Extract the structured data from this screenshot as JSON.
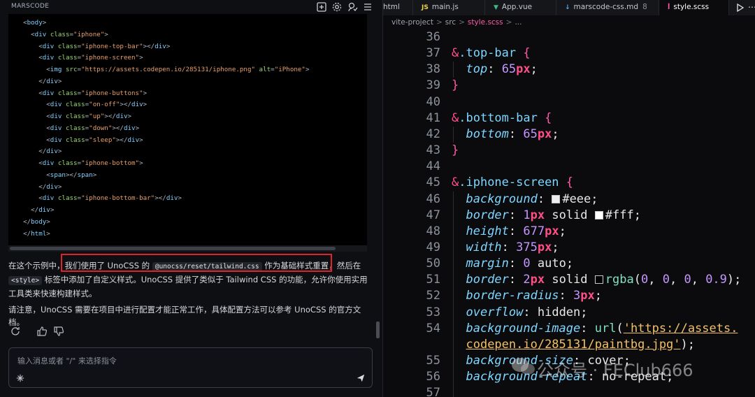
{
  "app": {
    "brand": "MARSCODE"
  },
  "left_header": {
    "icons": [
      "new-chat-icon",
      "gear-icon",
      "feedback-icon",
      "menu-icon"
    ]
  },
  "code_block": {
    "lines": [
      [
        [
          "t-pl",
          "  <"
        ],
        [
          "t-tag",
          "body"
        ],
        [
          "t-pl",
          ">"
        ]
      ],
      [
        [
          "t-pl",
          "    <"
        ],
        [
          "t-tag",
          "div "
        ],
        [
          "t-attr",
          "class"
        ],
        [
          "t-pl",
          "="
        ],
        [
          "t-str",
          "\"iphone\""
        ],
        [
          "t-pl",
          ">"
        ]
      ],
      [
        [
          "t-pl",
          "      <"
        ],
        [
          "t-tag",
          "div "
        ],
        [
          "t-attr",
          "class"
        ],
        [
          "t-pl",
          "="
        ],
        [
          "t-str",
          "\"iphone-top-bar\""
        ],
        [
          "t-pl",
          "></"
        ],
        [
          "t-tag",
          "div"
        ],
        [
          "t-pl",
          ">"
        ]
      ],
      [
        [
          "t-pl",
          "      <"
        ],
        [
          "t-tag",
          "div "
        ],
        [
          "t-attr",
          "class"
        ],
        [
          "t-pl",
          "="
        ],
        [
          "t-str",
          "\"iphone-screen\""
        ],
        [
          "t-pl",
          ">"
        ]
      ],
      [
        [
          "t-pl",
          "        <"
        ],
        [
          "t-tag",
          "img "
        ],
        [
          "t-attr",
          "src"
        ],
        [
          "t-pl",
          "="
        ],
        [
          "t-str",
          "\"https://assets.codepen.io/285131/iphone.png\" "
        ],
        [
          "t-attr",
          "alt"
        ],
        [
          "t-pl",
          "="
        ],
        [
          "t-str",
          "\"iPhone\""
        ],
        [
          "t-pl",
          ">"
        ]
      ],
      [
        [
          "t-pl",
          "      </"
        ],
        [
          "t-tag",
          "div"
        ],
        [
          "t-pl",
          ">"
        ]
      ],
      [
        [
          "t-pl",
          "      <"
        ],
        [
          "t-tag",
          "div "
        ],
        [
          "t-attr",
          "class"
        ],
        [
          "t-pl",
          "="
        ],
        [
          "t-str",
          "\"iphone-buttons\""
        ],
        [
          "t-pl",
          ">"
        ]
      ],
      [
        [
          "t-pl",
          "        <"
        ],
        [
          "t-tag",
          "div "
        ],
        [
          "t-attr",
          "class"
        ],
        [
          "t-pl",
          "="
        ],
        [
          "t-str",
          "\"on-off\""
        ],
        [
          "t-pl",
          "></"
        ],
        [
          "t-tag",
          "div"
        ],
        [
          "t-pl",
          ">"
        ]
      ],
      [
        [
          "t-pl",
          "        <"
        ],
        [
          "t-tag",
          "div "
        ],
        [
          "t-attr",
          "class"
        ],
        [
          "t-pl",
          "="
        ],
        [
          "t-str",
          "\"up\""
        ],
        [
          "t-pl",
          "></"
        ],
        [
          "t-tag",
          "div"
        ],
        [
          "t-pl",
          ">"
        ]
      ],
      [
        [
          "t-pl",
          "        <"
        ],
        [
          "t-tag",
          "div "
        ],
        [
          "t-attr",
          "class"
        ],
        [
          "t-pl",
          "="
        ],
        [
          "t-str",
          "\"down\""
        ],
        [
          "t-pl",
          "></"
        ],
        [
          "t-tag",
          "div"
        ],
        [
          "t-pl",
          ">"
        ]
      ],
      [
        [
          "t-pl",
          "        <"
        ],
        [
          "t-tag",
          "div "
        ],
        [
          "t-attr",
          "class"
        ],
        [
          "t-pl",
          "="
        ],
        [
          "t-str",
          "\"sleep\""
        ],
        [
          "t-pl",
          "></"
        ],
        [
          "t-tag",
          "div"
        ],
        [
          "t-pl",
          ">"
        ]
      ],
      [
        [
          "t-pl",
          "      </"
        ],
        [
          "t-tag",
          "div"
        ],
        [
          "t-pl",
          ">"
        ]
      ],
      [
        [
          "t-pl",
          "      <"
        ],
        [
          "t-tag",
          "div "
        ],
        [
          "t-attr",
          "class"
        ],
        [
          "t-pl",
          "="
        ],
        [
          "t-str",
          "\"iphone-bottom\""
        ],
        [
          "t-pl",
          ">"
        ]
      ],
      [
        [
          "t-pl",
          "        <"
        ],
        [
          "t-tag",
          "span"
        ],
        [
          "t-pl",
          "></"
        ],
        [
          "t-tag",
          "span"
        ],
        [
          "t-pl",
          ">"
        ]
      ],
      [
        [
          "t-pl",
          "      </"
        ],
        [
          "t-tag",
          "div"
        ],
        [
          "t-pl",
          ">"
        ]
      ],
      [
        [
          "t-pl",
          "      <"
        ],
        [
          "t-tag",
          "div "
        ],
        [
          "t-attr",
          "class"
        ],
        [
          "t-pl",
          "="
        ],
        [
          "t-str",
          "\"iphone-bottom-bar\""
        ],
        [
          "t-pl",
          "></"
        ],
        [
          "t-tag",
          "div"
        ],
        [
          "t-pl",
          ">"
        ]
      ],
      [
        [
          "t-pl",
          "    </"
        ],
        [
          "t-tag",
          "div"
        ],
        [
          "t-pl",
          ">"
        ]
      ],
      [
        [
          "t-pl",
          "  </"
        ],
        [
          "t-tag",
          "body"
        ],
        [
          "t-pl",
          ">"
        ]
      ],
      [
        [
          "t-pl",
          "  </"
        ],
        [
          "t-tag",
          "html"
        ],
        [
          "t-pl",
          ">"
        ]
      ]
    ]
  },
  "message": {
    "p1_a": "在这个示例中，我们使用了 UnoCSS 的 ",
    "p1_code1": "@unocss/reset/tailwind.css",
    "p1_b": " 作为基础样式重置，然后在 ",
    "p1_code2": "<style>",
    "p1_c": " 标签中添加了自定义样式。UnoCSS 提供了类似于 Tailwind CSS 的功能，允许你使用实用工具类来快速构建样式。",
    "p2": "请注意，UnoCSS 需要在项目中进行配置才能正常工作，具体配置方法可以参考 UnoCSS 的官方文档。"
  },
  "actions": {
    "icons": [
      "refresh-icon",
      "thumbs-up-icon",
      "thumbs-down-icon"
    ]
  },
  "chat_input": {
    "placeholder": "输入消息或者 \"/\" 来选择指令"
  },
  "tabs": [
    {
      "label": "html",
      "icon": "",
      "color": "#c3c7cf",
      "badge": ""
    },
    {
      "label": "main.js",
      "icon": "JS",
      "color": "#f0d24a",
      "badge": ""
    },
    {
      "label": "App.vue",
      "icon": "▼",
      "color": "#3fb984",
      "badge": ""
    },
    {
      "label": "marscode-css.md",
      "icon": "↓",
      "color": "#5aa2ff",
      "badge": "8"
    },
    {
      "label": "style.scss",
      "icon": "ꟾ",
      "color": "#ff5aa8",
      "badge": ""
    }
  ],
  "editor_actions": {
    "icons": [
      "run-icon",
      "more-icon"
    ]
  },
  "breadcrumb": [
    "vite-project",
    "src",
    "style.scss",
    "..."
  ],
  "editor": {
    "lines": [
      {
        "n": "36",
        "t": []
      },
      {
        "n": "37",
        "t": [
          [
            "c-amp",
            "&"
          ],
          [
            "c-sel",
            ".top-bar "
          ],
          [
            "c-brace",
            "{"
          ]
        ]
      },
      {
        "n": "38",
        "t": [
          [
            "c-val",
            "  "
          ],
          [
            "c-prop",
            "top"
          ],
          [
            "c-punc",
            ": "
          ],
          [
            "c-num",
            "65"
          ],
          [
            "c-unit",
            "px"
          ],
          [
            "c-punc",
            ";"
          ]
        ]
      },
      {
        "n": "39",
        "t": [
          [
            "c-brace",
            "}"
          ]
        ]
      },
      {
        "n": "40",
        "t": []
      },
      {
        "n": "41",
        "t": [
          [
            "c-amp",
            "&"
          ],
          [
            "c-sel",
            ".bottom-bar "
          ],
          [
            "c-brace",
            "{"
          ]
        ]
      },
      {
        "n": "42",
        "t": [
          [
            "c-val",
            "  "
          ],
          [
            "c-prop",
            "bottom"
          ],
          [
            "c-punc",
            ": "
          ],
          [
            "c-num",
            "65"
          ],
          [
            "c-unit",
            "px"
          ],
          [
            "c-punc",
            ";"
          ]
        ]
      },
      {
        "n": "43",
        "t": [
          [
            "c-brace",
            "}"
          ]
        ]
      },
      {
        "n": "44",
        "t": []
      },
      {
        "n": "45",
        "t": [
          [
            "c-amp",
            "&"
          ],
          [
            "c-sel",
            ".iphone-screen "
          ],
          [
            "c-brace",
            "{"
          ]
        ]
      },
      {
        "n": "46",
        "t": [
          [
            "c-val",
            "  "
          ],
          [
            "c-prop",
            "background"
          ],
          [
            "c-punc",
            ": "
          ],
          [
            "sw",
            "#eeeeee"
          ],
          [
            "c-val",
            "#eee"
          ],
          [
            "c-punc",
            ";"
          ]
        ]
      },
      {
        "n": "47",
        "t": [
          [
            "c-val",
            "  "
          ],
          [
            "c-prop",
            "border"
          ],
          [
            "c-punc",
            ": "
          ],
          [
            "c-num",
            "1"
          ],
          [
            "c-unit",
            "px"
          ],
          [
            "c-val",
            " solid "
          ],
          [
            "sw",
            "#ffffff"
          ],
          [
            "c-val",
            "#fff"
          ],
          [
            "c-punc",
            ";"
          ]
        ]
      },
      {
        "n": "48",
        "t": [
          [
            "c-val",
            "  "
          ],
          [
            "c-prop",
            "height"
          ],
          [
            "c-punc",
            ": "
          ],
          [
            "c-num",
            "677"
          ],
          [
            "c-unit",
            "px"
          ],
          [
            "c-punc",
            ";"
          ]
        ]
      },
      {
        "n": "49",
        "t": [
          [
            "c-val",
            "  "
          ],
          [
            "c-prop",
            "width"
          ],
          [
            "c-punc",
            ": "
          ],
          [
            "c-num",
            "375"
          ],
          [
            "c-unit",
            "px"
          ],
          [
            "c-punc",
            ";"
          ]
        ]
      },
      {
        "n": "50",
        "t": [
          [
            "c-val",
            "  "
          ],
          [
            "c-prop",
            "margin"
          ],
          [
            "c-punc",
            ": "
          ],
          [
            "c-num",
            "0"
          ],
          [
            "c-val",
            " auto"
          ],
          [
            "c-punc",
            ";"
          ]
        ]
      },
      {
        "n": "51",
        "t": [
          [
            "c-val",
            "  "
          ],
          [
            "c-prop",
            "border"
          ],
          [
            "c-punc",
            ": "
          ],
          [
            "c-num",
            "2"
          ],
          [
            "c-unit",
            "px"
          ],
          [
            "c-val",
            " solid "
          ],
          [
            "sw",
            "#000000"
          ],
          [
            "c-fn",
            "rgba"
          ],
          [
            "c-punc",
            "("
          ],
          [
            "c-num",
            "0"
          ],
          [
            "c-punc",
            ", "
          ],
          [
            "c-num",
            "0"
          ],
          [
            "c-punc",
            ", "
          ],
          [
            "c-num",
            "0"
          ],
          [
            "c-punc",
            ", "
          ],
          [
            "c-num",
            "0.9"
          ],
          [
            "c-punc",
            ");"
          ]
        ]
      },
      {
        "n": "52",
        "t": [
          [
            "c-val",
            "  "
          ],
          [
            "c-prop",
            "border-radius"
          ],
          [
            "c-punc",
            ": "
          ],
          [
            "c-num",
            "3"
          ],
          [
            "c-unit",
            "px"
          ],
          [
            "c-punc",
            ";"
          ]
        ]
      },
      {
        "n": "53",
        "t": [
          [
            "c-val",
            "  "
          ],
          [
            "c-prop",
            "overflow"
          ],
          [
            "c-punc",
            ": "
          ],
          [
            "c-val",
            "hidden"
          ],
          [
            "c-punc",
            ";"
          ]
        ]
      },
      {
        "n": "54",
        "t": [
          [
            "c-val",
            "  "
          ],
          [
            "c-prop",
            "background-image"
          ],
          [
            "c-punc",
            ": "
          ],
          [
            "c-fn",
            "url"
          ],
          [
            "c-punc",
            "("
          ],
          [
            "c-str",
            "'https://assets."
          ]
        ]
      },
      {
        "n": "",
        "t": [
          [
            "c-val",
            "  "
          ],
          [
            "c-str",
            "codepen.io/285131/paintbg.jpg'"
          ],
          [
            "c-punc",
            ");"
          ]
        ]
      },
      {
        "n": "55",
        "t": [
          [
            "c-val",
            "  "
          ],
          [
            "c-prop",
            "background-size"
          ],
          [
            "c-punc",
            ": "
          ],
          [
            "c-val",
            "cover"
          ],
          [
            "c-punc",
            ";"
          ]
        ]
      },
      {
        "n": "56",
        "t": [
          [
            "c-val",
            "  "
          ],
          [
            "c-prop",
            "background-repeat"
          ],
          [
            "c-punc",
            ": "
          ],
          [
            "c-val",
            "no-repeat"
          ],
          [
            "c-punc",
            ";"
          ]
        ]
      },
      {
        "n": "57",
        "t": []
      }
    ]
  },
  "watermark": {
    "text": "公众号 · FEClub666"
  },
  "colors": {
    "highlight_box": "#e0222a",
    "accent_pink": "#ff4f86"
  }
}
